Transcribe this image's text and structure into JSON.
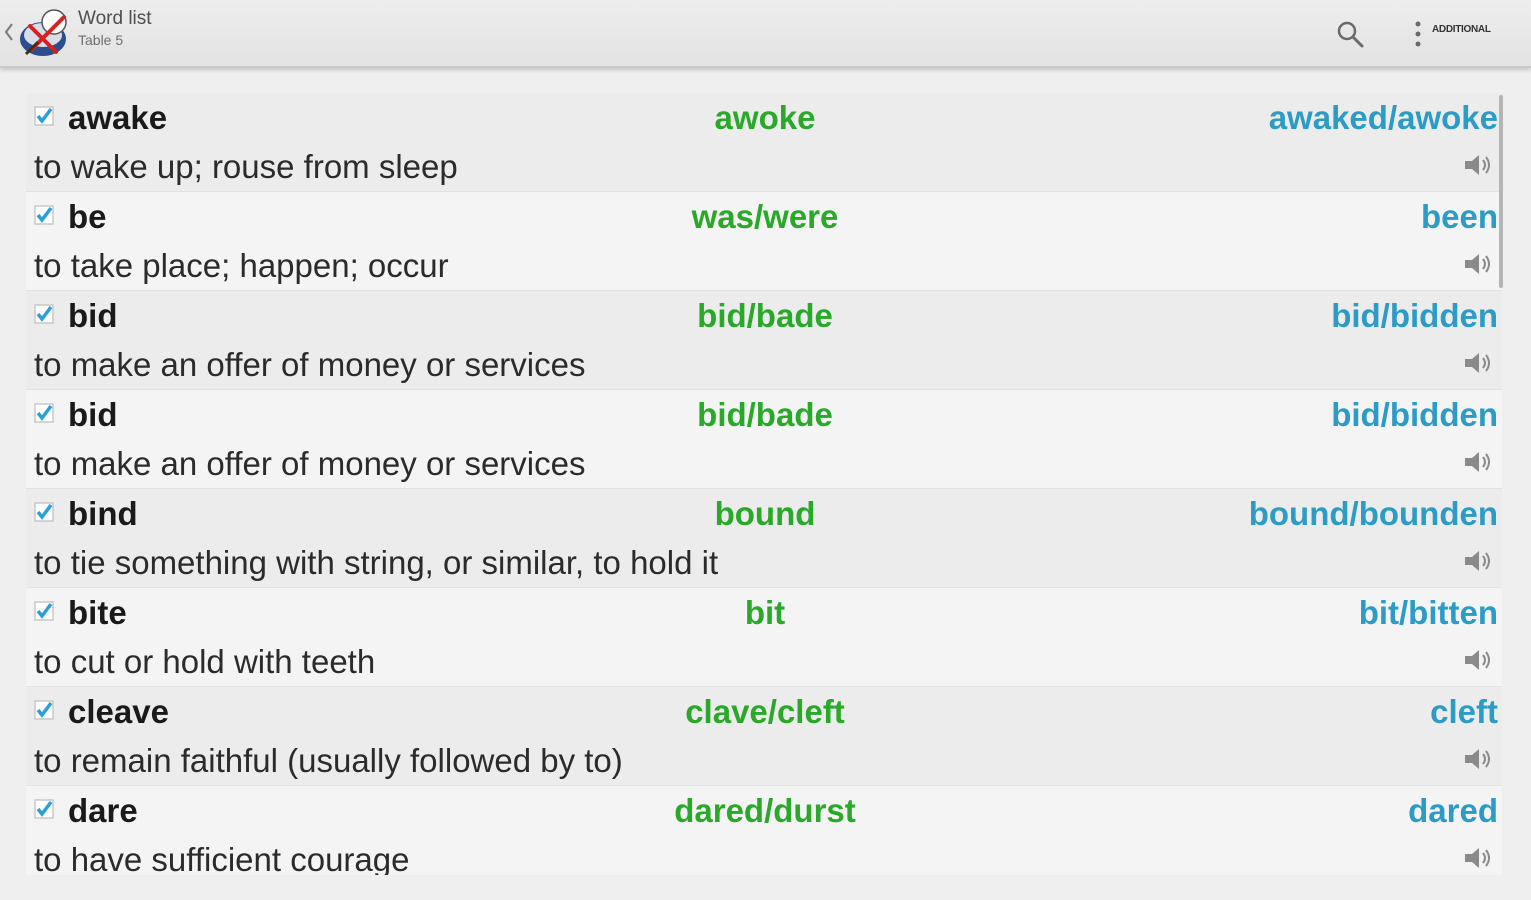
{
  "actionbar": {
    "title": "Word list",
    "subtitle": "Table 5",
    "additional_label": "ADDITIONAL"
  },
  "colors": {
    "past": "#29a829",
    "participle": "#2c9bc6",
    "check": "#2aa0d8"
  },
  "rows": [
    {
      "word": "awake",
      "past": "awoke",
      "participle": "awaked/awoke",
      "definition": "to wake up; rouse from sleep"
    },
    {
      "word": "be",
      "past": "was/were",
      "participle": "been",
      "definition": "to take place; happen; occur"
    },
    {
      "word": "bid",
      "past": "bid/bade",
      "participle": "bid/bidden",
      "definition": "to make an offer of money or services"
    },
    {
      "word": "bid",
      "past": "bid/bade",
      "participle": "bid/bidden",
      "definition": "to make an offer of money or services"
    },
    {
      "word": "bind",
      "past": "bound",
      "participle": "bound/bounden",
      "definition": "to tie something with string, or similar, to hold it"
    },
    {
      "word": "bite",
      "past": "bit",
      "participle": "bit/bitten",
      "definition": "to cut or hold with teeth"
    },
    {
      "word": "cleave",
      "past": "clave/cleft",
      "participle": "cleft",
      "definition": "to remain faithful (usually followed by to)"
    },
    {
      "word": "dare",
      "past": "dared/durst",
      "participle": "dared",
      "definition": "to have sufficient courage"
    }
  ]
}
